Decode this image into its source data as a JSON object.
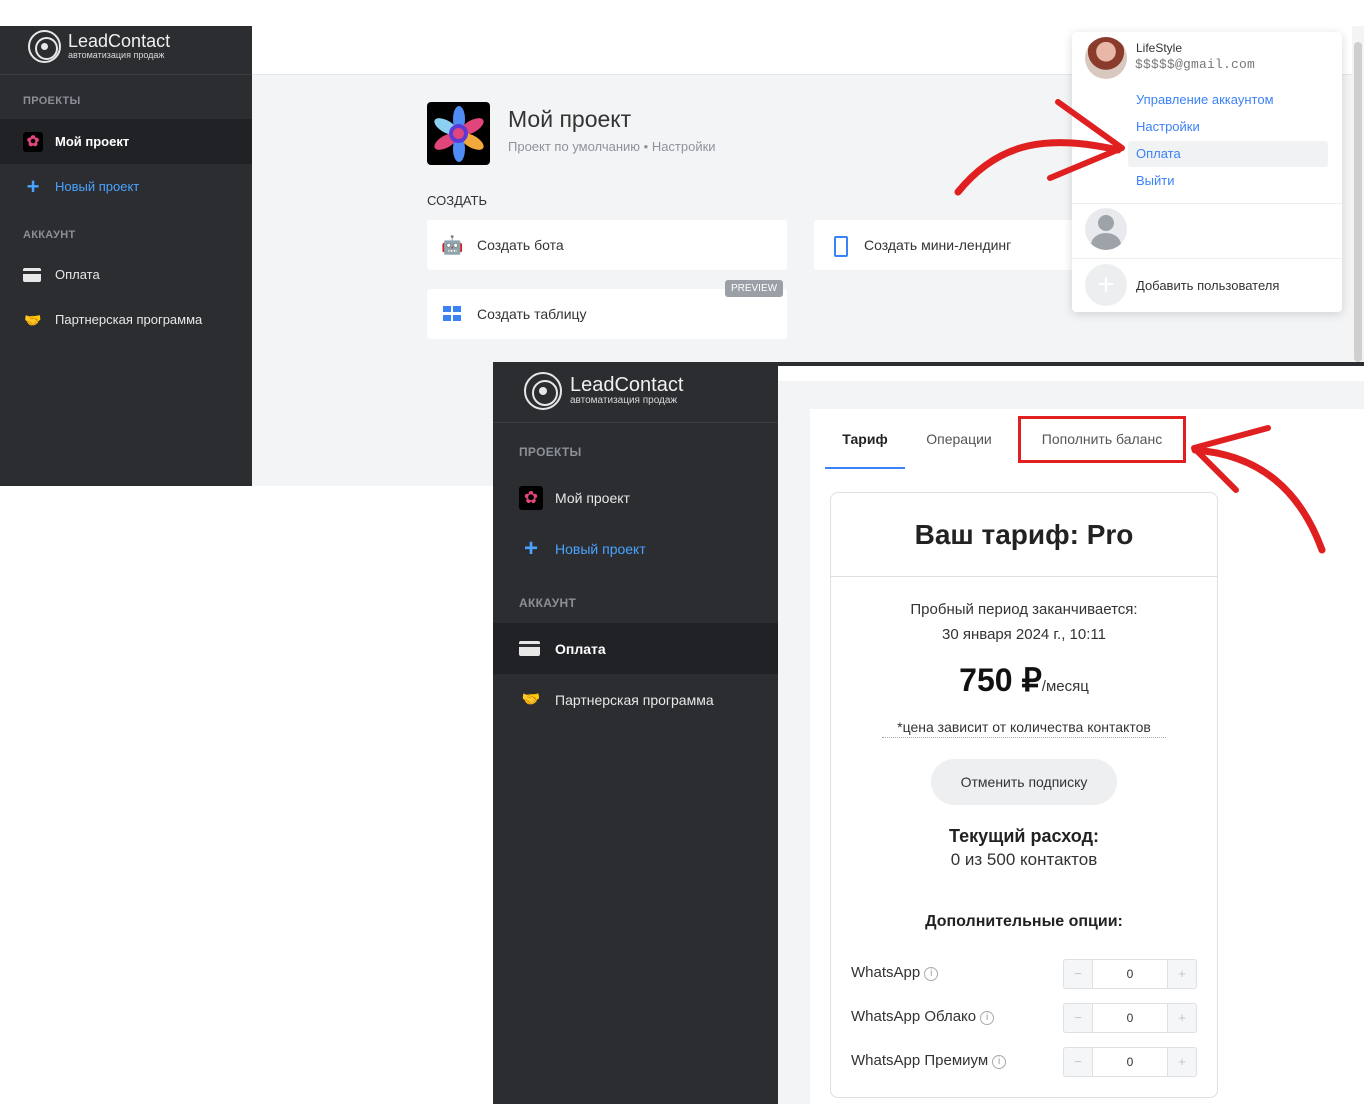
{
  "brand": {
    "name": "LeadContact",
    "tagline": "автоматизация продаж"
  },
  "screen1": {
    "sidebar": {
      "section_projects": "ПРОЕКТЫ",
      "project": "Мой проект",
      "new_project": "Новый проект",
      "section_account": "АККАУНТ",
      "payment": "Оплата",
      "partner": "Партнерская программа"
    },
    "project": {
      "title": "Мой проект",
      "subtitle": "Проект по умолчанию • Настройки"
    },
    "create": {
      "heading": "СОЗДАТЬ",
      "bot": "Создать бота",
      "landing": "Создать мини-лендинг",
      "table": "Создать таблицу",
      "preview_badge": "PREVIEW"
    },
    "dropdown": {
      "name": "LifeStyle",
      "email": "$$$$$@gmail.com",
      "manage": "Управление аккаунтом",
      "settings": "Настройки",
      "payment": "Оплата",
      "logout": "Выйти",
      "add_user": "Добавить пользователя"
    }
  },
  "screen2": {
    "sidebar": {
      "section_projects": "ПРОЕКТЫ",
      "project": "Мой проект",
      "new_project": "Новый проект",
      "section_account": "АККАУНТ",
      "payment": "Оплата",
      "partner": "Партнерская программа"
    },
    "tabs": {
      "tariff": "Тариф",
      "operations": "Операции",
      "topup": "Пополнить баланс"
    },
    "tariff": {
      "title": "Ваш тариф: Pro",
      "trial_line1": "Пробный период заканчивается:",
      "trial_line2": "30 января 2024 г., 10:11",
      "price": "750 ₽",
      "per": "/месяц",
      "note": "*цена зависит от количества контактов",
      "cancel": "Отменить подписку",
      "usage_title": "Текущий расход:",
      "usage_value": "0 из 500 контактов",
      "options_title": "Дополнительные опции:",
      "options": [
        {
          "label": "WhatsApp",
          "value": "0"
        },
        {
          "label": "WhatsApp Облако",
          "value": "0"
        },
        {
          "label": "WhatsApp Премиум",
          "value": "0"
        }
      ]
    }
  },
  "colors": {
    "sidebar": "#2b2d31",
    "accent": "#3b82f6",
    "highlight": "#e02020"
  }
}
